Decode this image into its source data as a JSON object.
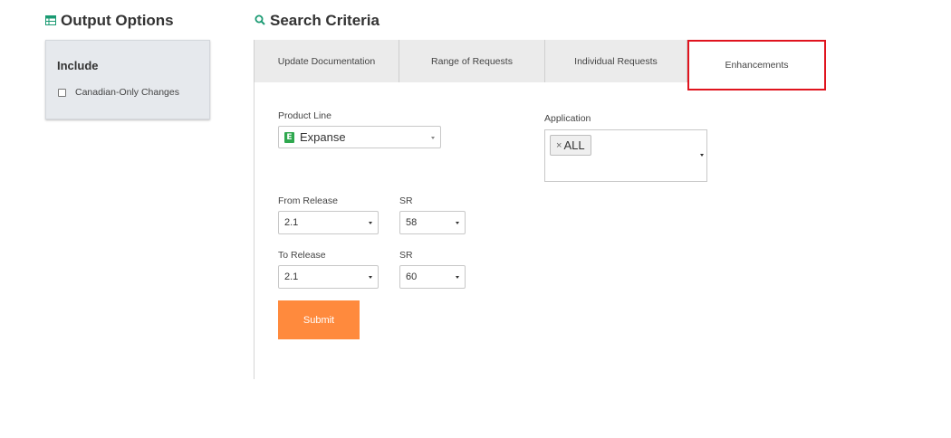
{
  "output_options": {
    "title": "Output Options",
    "icon": "table-icon",
    "panel": {
      "title": "Include",
      "checkbox_label": "Canadian-Only Changes",
      "checked": false
    }
  },
  "search_criteria": {
    "title": "Search Criteria",
    "icon": "search-icon"
  },
  "tabs": [
    {
      "label": "Update Documentation"
    },
    {
      "label": "Range of Requests"
    },
    {
      "label": "Individual Requests"
    },
    {
      "label": "Enhancements",
      "selected": true
    }
  ],
  "form": {
    "product_line_label": "Product Line",
    "product_line_value": "Expanse",
    "product_icon_letter": "E",
    "application_label": "Application",
    "application_tag": "ALL",
    "from_release_label": "From Release",
    "from_release_value": "2.1",
    "from_sr_label": "SR",
    "from_sr_value": "58",
    "to_release_label": "To Release",
    "to_release_value": "2.1",
    "to_sr_label": "SR",
    "to_sr_value": "60",
    "submit_label": "Submit"
  },
  "colors": {
    "accent_green": "#1a9a72",
    "submit_orange": "#ff8a3d",
    "highlight_red": "#e0141e",
    "product_icon_green": "#2fa84f"
  }
}
